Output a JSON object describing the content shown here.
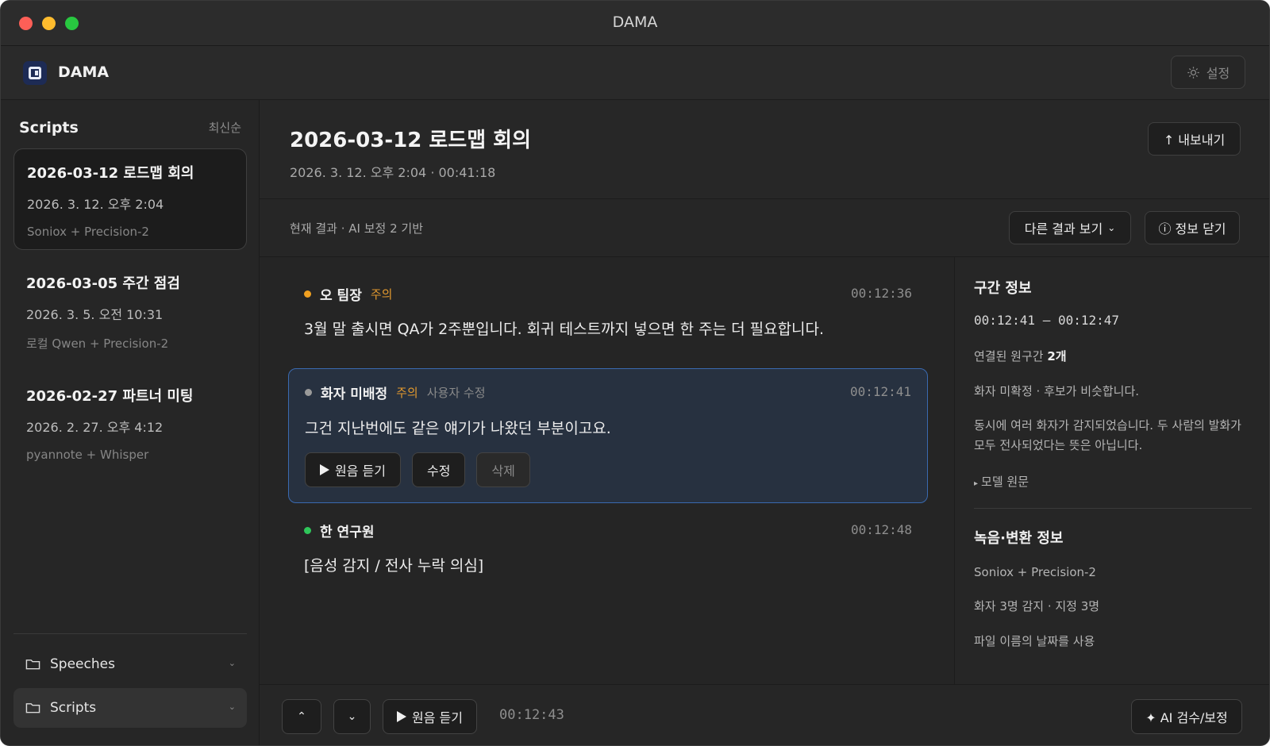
{
  "window": {
    "title": "DAMA"
  },
  "app": {
    "name": "DAMA",
    "settings_label": "설정"
  },
  "sidebar": {
    "title": "Scripts",
    "sort": "최신순",
    "scripts": [
      {
        "title": "2026-03-12 로드맵 회의",
        "date": "2026. 3. 12. 오후 2:04",
        "model": "Soniox + Precision-2"
      },
      {
        "title": "2026-03-05 주간 점검",
        "date": "2026. 3. 5. 오전 10:31",
        "model": "로컬 Qwen + Precision-2"
      },
      {
        "title": "2026-02-27 파트너 미팅",
        "date": "2026. 2. 27. 오후 4:12",
        "model": "pyannote + Whisper"
      }
    ],
    "folders": [
      {
        "label": "Speeches"
      },
      {
        "label": "Scripts"
      }
    ]
  },
  "doc": {
    "title": "2026-03-12 로드맵 회의",
    "meta": "2026. 3. 12. 오후 2:04 · 00:41:18",
    "export_label": "↑ 내보내기",
    "result_label": "현재 결과 · AI 보정 2 기반",
    "other_results_label": "다른 결과 보기",
    "close_info_label": "ⓘ 정보 닫기"
  },
  "segments": [
    {
      "speaker": "오 팀장",
      "warning": "주의",
      "timestamp": "00:12:36",
      "text": "3월 말 출시면 QA가 2주뿐입니다. 회귀 테스트까지 넣으면 한 주는 더 필요합니다.",
      "dot_color": "#f0a020"
    },
    {
      "speaker": "화자 미배정",
      "warning": "주의",
      "edited": "사용자 수정",
      "timestamp": "00:12:41",
      "text": "그건 지난번에도 같은 얘기가 나왔던 부분이고요.",
      "dot_color": "#9a9a9a",
      "actions": {
        "play": "원음 듣기",
        "edit": "수정",
        "delete": "삭제"
      }
    },
    {
      "speaker": "한 연구원",
      "timestamp": "00:12:48",
      "text": "[음성 감지 / 전사 누락 의심]",
      "dot_color": "#2fc65a"
    }
  ],
  "info": {
    "segment_title": "구간 정보",
    "range": "00:12:41 – 00:12:47",
    "linked_prefix": "연결된 원구간",
    "linked_count": "2개",
    "speaker_note": "화자 미확정 · 후보가 비슷합니다.",
    "overlap_note": "동시에 여러 화자가 감지되었습니다. 두 사람의 발화가 모두 전사되었다는 뜻은 아닙니다.",
    "model_raw": "모델 원문",
    "recording_title": "녹음·변환 정보",
    "engine": "Soniox + Precision-2",
    "speakers": "화자 3명 감지 · 지정 3명",
    "filename_date": "파일 이름의 날짜를 사용"
  },
  "bottom": {
    "play_label": "원음 듣기",
    "time": "00:12:43",
    "ai_label": "✦ AI 검수/보정"
  }
}
